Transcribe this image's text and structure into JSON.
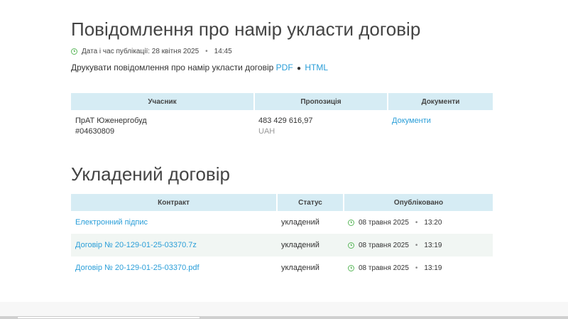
{
  "notice": {
    "title": "Повідомлення про намір укласти договір",
    "published_label": "Дата і час публікації: 28 квітня 2025",
    "published_time": "14:45",
    "print_text": "Друкувати повідомлення про намір укласти договір",
    "pdf_label": "PDF",
    "bullet": "●",
    "html_label": "HTML"
  },
  "participants_table": {
    "headers": [
      "Учасник",
      "Пропозиція",
      "Документи"
    ],
    "row": {
      "name": "ПрАТ Юженергобуд",
      "code": "#04630809",
      "amount": "483 429 616,97",
      "currency": "UAH",
      "documents_link": "Документи"
    }
  },
  "contract": {
    "title": "Укладений договір",
    "headers": [
      "Контракт",
      "Статус",
      "Опубліковано"
    ],
    "rows": [
      {
        "name": "Електронний підпис",
        "status": "укладений",
        "date": "08 травня 2025",
        "time": "13:20"
      },
      {
        "name": "Договір № 20-129-01-25-03370.7z",
        "status": "укладений",
        "date": "08 травня 2025",
        "time": "13:19"
      },
      {
        "name": "Договір № 20-129-01-25-03370.pdf",
        "status": "укладений",
        "date": "08 травня 2025",
        "time": "13:19"
      }
    ]
  },
  "colors": {
    "link": "#2a9ed8",
    "header_bg": "#d6ecf4",
    "clock": "#5cb85c"
  }
}
